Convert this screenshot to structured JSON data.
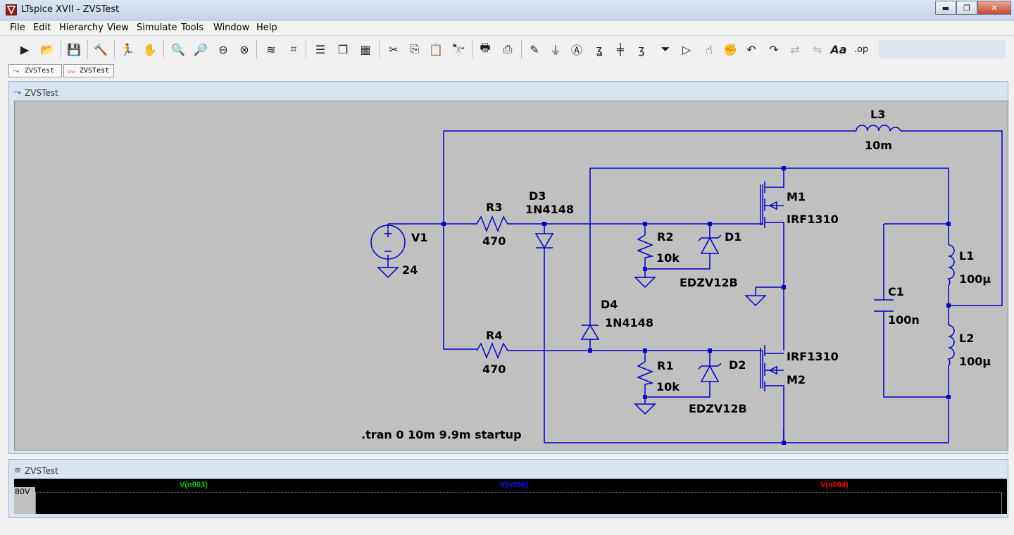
{
  "window": {
    "title": "LTspice XVII - ZVSTest",
    "min": "▬",
    "max": "❐",
    "close": "✕"
  },
  "menu": [
    "File",
    "Edit",
    "Hierarchy",
    "View",
    "Simulate",
    "Tools",
    "Window",
    "Help"
  ],
  "tabs": [
    {
      "label": "ZVSTest"
    },
    {
      "label": "ZVSTest"
    }
  ],
  "schematic_window": {
    "title": "ZVSTest"
  },
  "plot_window": {
    "title": "ZVSTest"
  },
  "components": {
    "L3": {
      "name": "L3",
      "value": "10m"
    },
    "V1": {
      "name": "V1",
      "value": "24"
    },
    "R3": {
      "name": "R3",
      "value": "470"
    },
    "D3": {
      "name": "D3",
      "value": "1N4148"
    },
    "R2": {
      "name": "R2",
      "value": "10k"
    },
    "D1": {
      "name": "D1",
      "value": "EDZV12B"
    },
    "M1": {
      "name": "M1",
      "value": "IRF1310"
    },
    "D4": {
      "name": "D4",
      "value": "1N4148"
    },
    "R4": {
      "name": "R4",
      "value": "470"
    },
    "R1": {
      "name": "R1",
      "value": "10k"
    },
    "D2": {
      "name": "D2",
      "value": "EDZV12B"
    },
    "M2": {
      "name": "M2",
      "value": "IRF1310"
    },
    "C1": {
      "name": "C1",
      "value": "100n"
    },
    "L1": {
      "name": "L1",
      "value": "100µ"
    },
    "L2": {
      "name": "L2",
      "value": "100µ"
    }
  },
  "directive": ".tran 0 10m 9.9m startup",
  "plot": {
    "ytick": "80V",
    "traces": [
      {
        "name": "V(n003)",
        "color": "#00cc00"
      },
      {
        "name": "V(n006)",
        "color": "#1010ff"
      },
      {
        "name": "V(n004)",
        "color": "#ff0000"
      }
    ]
  },
  "colors": {
    "wire": "#0000c8",
    "schematic_bg": "#c0c0c0",
    "titlebar": "#c4d3e4"
  },
  "toolbar_icons": [
    "run-icon",
    "open-icon",
    "save-icon",
    "control-panel-icon",
    "run-sim-icon",
    "halt-icon",
    "zoom-in-icon",
    "zoom-pan-icon",
    "zoom-out-icon",
    "zoom-fit-icon",
    "autorange-icon",
    "delete-trace-icon",
    "tile-horizontal-icon",
    "cascade-icon",
    "tile-vertical-icon",
    "cut-icon",
    "copy-icon",
    "paste-icon",
    "find-icon",
    "print-icon",
    "print-preview-icon",
    "wire-icon",
    "ground-icon",
    "label-icon",
    "resistor-icon",
    "capacitor-icon",
    "inductor-icon",
    "diode-icon",
    "component-icon",
    "move-icon",
    "drag-icon",
    "undo-icon",
    "redo-icon",
    "rotate-icon",
    "mirror-icon",
    "text-icon",
    "spice-directive-icon"
  ]
}
